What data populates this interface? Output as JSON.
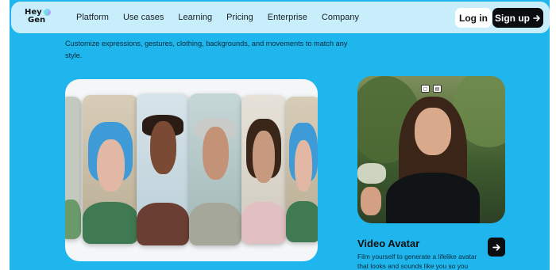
{
  "nav": {
    "logo_line1": "Hey",
    "logo_line2": "Gen",
    "links": [
      "Platform",
      "Use cases",
      "Learning",
      "Pricing",
      "Enterprise",
      "Company"
    ],
    "login_label": "Log in",
    "signup_label": "Sign up",
    "signup_icon": "arrow-right-icon",
    "logo_icon": "heygen-logo-mark"
  },
  "intro": {
    "line_partial": "Customize expressions, gestures, clothing, backgrounds, and movements to match any style."
  },
  "feature": {
    "title": "Video Avatar",
    "description": "Film yourself to generate a lifelike avatar that looks and sounds like you so you",
    "arrow_icon": "arrow-right-icon",
    "controls": [
      "picture-in-picture-icon",
      "caption-icon"
    ]
  },
  "colors": {
    "background": "#1fb6ee",
    "navbar": "#c8eefc",
    "dark": "#0b0d10"
  }
}
